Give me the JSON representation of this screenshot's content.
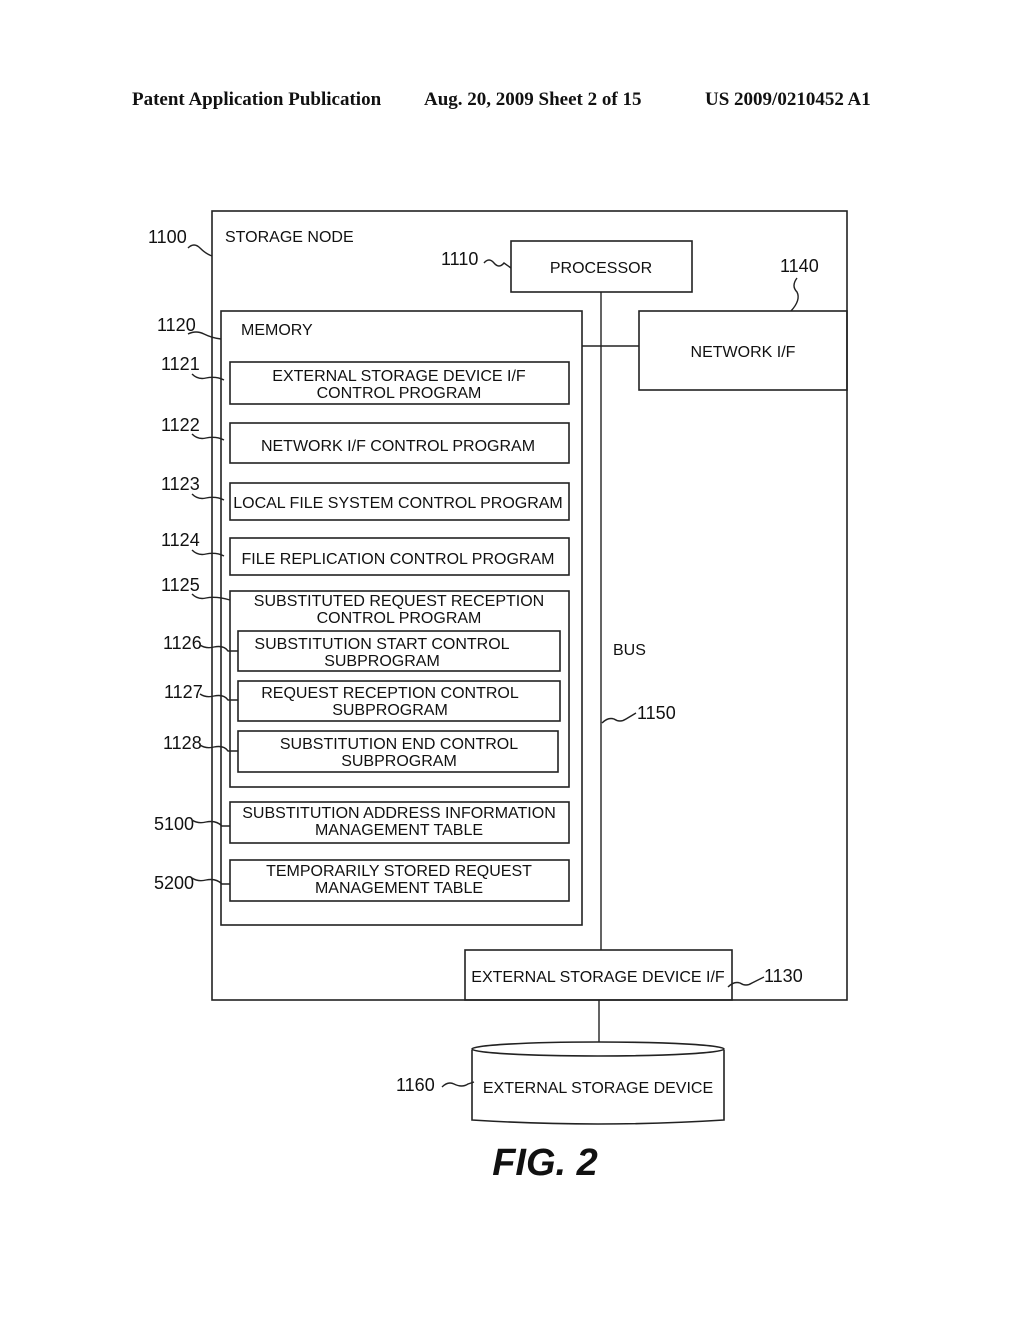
{
  "header": {
    "publication": "Patent Application Publication",
    "date_sheet": "Aug. 20, 2009  Sheet 2 of 15",
    "number": "US 2009/0210452 A1"
  },
  "diagram": {
    "storage_node": {
      "ref": "1100",
      "label": "STORAGE NODE"
    },
    "processor": {
      "ref": "1110",
      "label": "PROCESSOR"
    },
    "network_if": {
      "ref": "1140",
      "label": "NETWORK I/F"
    },
    "memory": {
      "ref": "1120",
      "label": "MEMORY"
    },
    "programs": [
      {
        "ref": "1121",
        "line1": "EXTERNAL STORAGE DEVICE I/F",
        "line2": "CONTROL PROGRAM"
      },
      {
        "ref": "1122",
        "line1": "NETWORK I/F CONTROL PROGRAM",
        "line2": ""
      },
      {
        "ref": "1123",
        "line1": "LOCAL FILE SYSTEM CONTROL PROGRAM",
        "line2": ""
      },
      {
        "ref": "1124",
        "line1": "FILE REPLICATION CONTROL PROGRAM",
        "line2": ""
      }
    ],
    "substituted": {
      "ref": "1125",
      "line1": "SUBSTITUTED REQUEST RECEPTION",
      "line2": "CONTROL PROGRAM",
      "subprograms": [
        {
          "ref": "1126",
          "line1": "SUBSTITUTION START CONTROL",
          "line2": "SUBPROGRAM"
        },
        {
          "ref": "1127",
          "line1": "REQUEST RECEPTION CONTROL",
          "line2": "SUBPROGRAM"
        },
        {
          "ref": "1128",
          "line1": "SUBSTITUTION END CONTROL",
          "line2": "SUBPROGRAM"
        }
      ]
    },
    "tables": [
      {
        "ref": "5100",
        "line1": "SUBSTITUTION ADDRESS INFORMATION",
        "line2": "MANAGEMENT TABLE"
      },
      {
        "ref": "5200",
        "line1": "TEMPORARILY STORED REQUEST",
        "line2": "MANAGEMENT TABLE"
      }
    ],
    "bus": {
      "ref": "1150",
      "label": "BUS"
    },
    "ext_storage_if": {
      "ref": "1130",
      "label": "EXTERNAL STORAGE DEVICE I/F"
    },
    "ext_storage": {
      "ref": "1160",
      "label": "EXTERNAL STORAGE DEVICE"
    },
    "figure_label": "FIG. 2"
  }
}
